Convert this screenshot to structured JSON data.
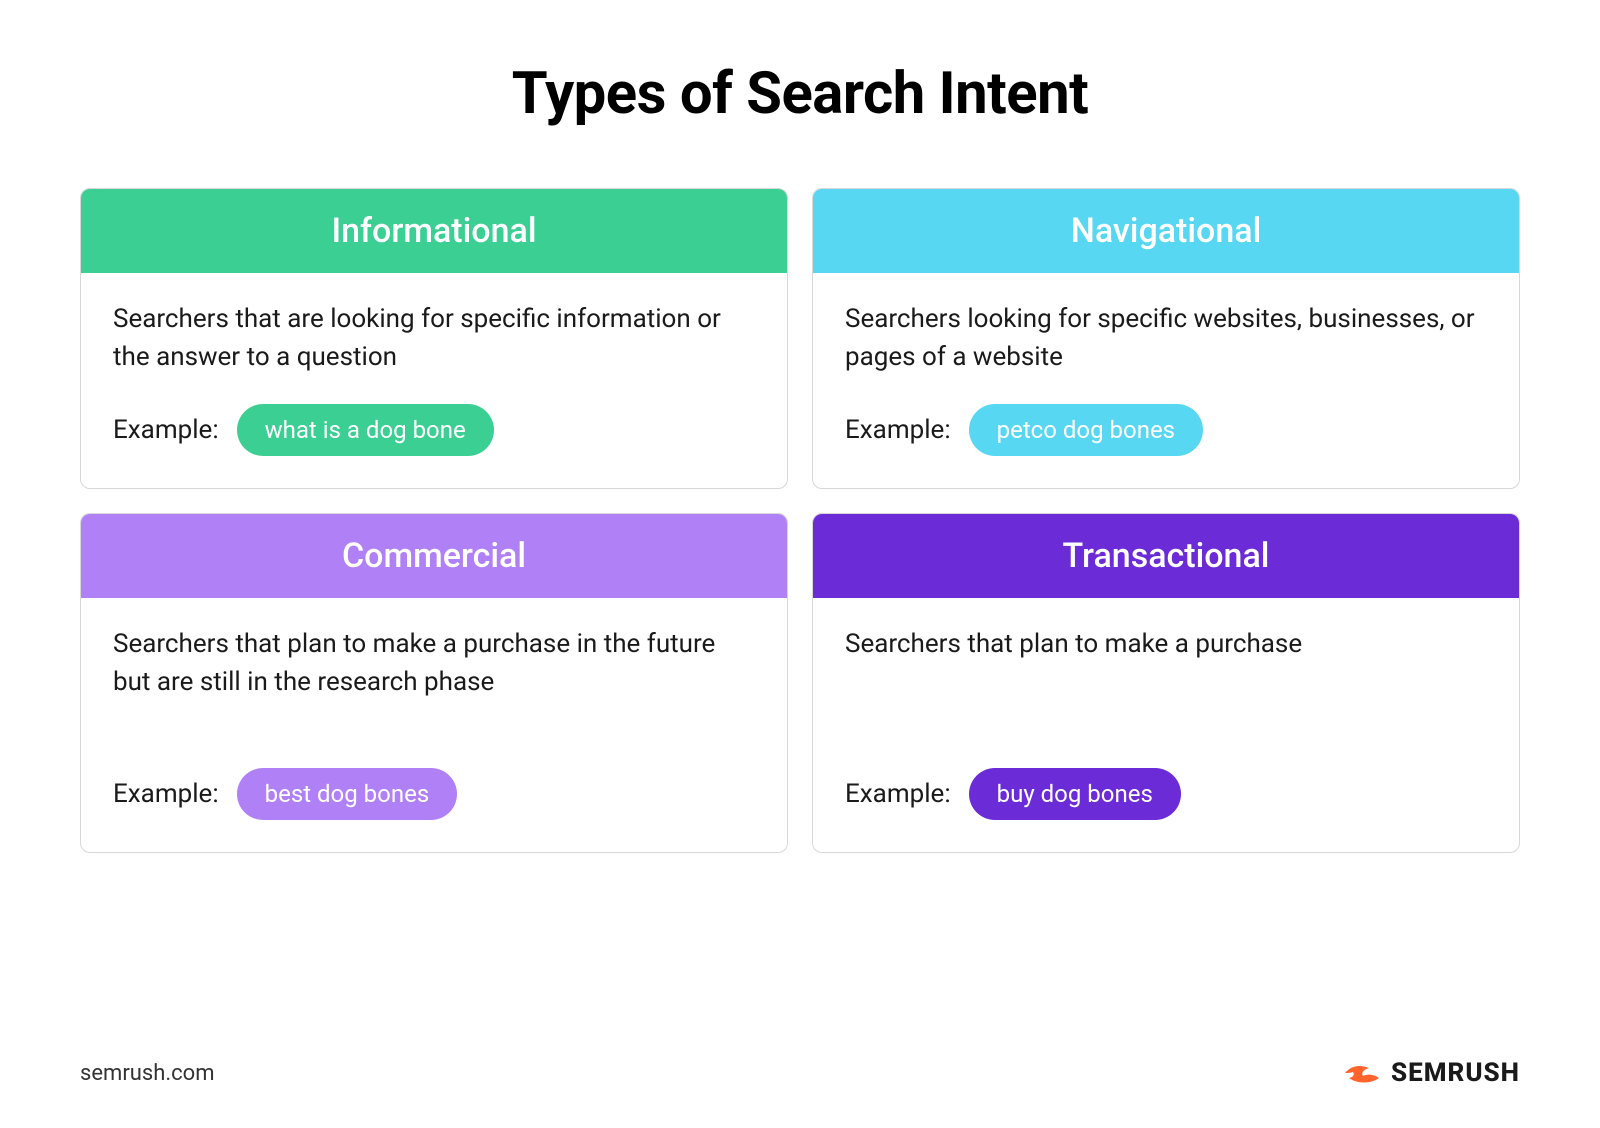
{
  "title": "Types of Search Intent",
  "cards": [
    {
      "name": "Informational",
      "desc": "Searchers that are looking for specific information or the answer to a question",
      "example_label": "Example:",
      "example": "what is a dog bone",
      "header_color": "#3bcf93",
      "pill_color": "#3bcf93"
    },
    {
      "name": "Navigational",
      "desc": "Searchers looking for specific websites, businesses, or pages of a website",
      "example_label": "Example:",
      "example": "petco dog bones",
      "header_color": "#57d7f2",
      "pill_color": "#57d7f2"
    },
    {
      "name": "Commercial",
      "desc": "Searchers that plan to make a purchase in the future but are still in the research phase",
      "example_label": "Example:",
      "example": "best dog bones",
      "header_color": "#b080f7",
      "pill_color": "#b080f7"
    },
    {
      "name": "Transactional",
      "desc": "Searchers that plan to make a purchase",
      "example_label": "Example:",
      "example": "buy dog bones",
      "header_color": "#6b2bd6",
      "pill_color": "#6b2bd6"
    }
  ],
  "footer": {
    "url": "semrush.com",
    "brand": "SEMRUSH"
  }
}
